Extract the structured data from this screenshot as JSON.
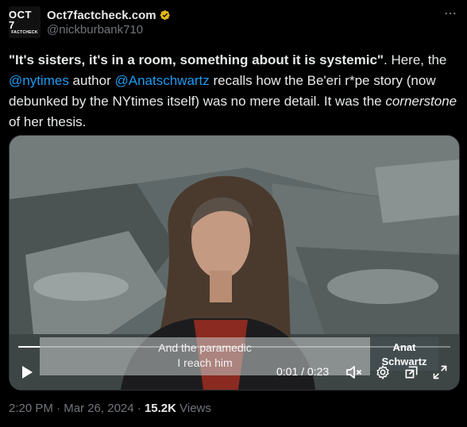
{
  "author": {
    "avatar_line1": "OCT 7",
    "avatar_line2": "FACTCHECK",
    "display_name": "Oct7factcheck.com",
    "handle": "@nickburbank710"
  },
  "tweet": {
    "quote": "\"It's sisters, it's in a room, something about it is systemic\"",
    "text_after_quote": ". Here, the ",
    "mention1": "@nytimes",
    "text_mid1": " author ",
    "mention2": "@Anatschwartz",
    "text_mid2": " recalls how the Be'eri r*pe story (now debunked by the NYtimes itself) was no mere detail. It was the ",
    "emphasis": "cornerstone",
    "text_end": " of her thesis."
  },
  "video": {
    "caption_line1": "And the paramedic",
    "caption_line2": "I reach him",
    "name_tag_line1": "Anat",
    "name_tag_line2": "Schwartz",
    "current_time": "0:01",
    "duration": "0:23",
    "time_display": "0:01 / 0:23",
    "progress_fraction": 0.05
  },
  "footer": {
    "time": "2:20 PM",
    "date": "Mar 26, 2024",
    "separator": " · ",
    "views_count": "15.2K",
    "views_label": " Views"
  },
  "colors": {
    "background": "#000000",
    "text_primary": "#e7e9ea",
    "text_secondary": "#71767b",
    "link": "#1d9bf0",
    "verified_badge": "#e2b719"
  },
  "icons": [
    "verified-badge-icon",
    "more-options-icon",
    "play-icon",
    "mute-icon",
    "settings-gear-icon",
    "picture-in-picture-icon",
    "fullscreen-icon"
  ]
}
